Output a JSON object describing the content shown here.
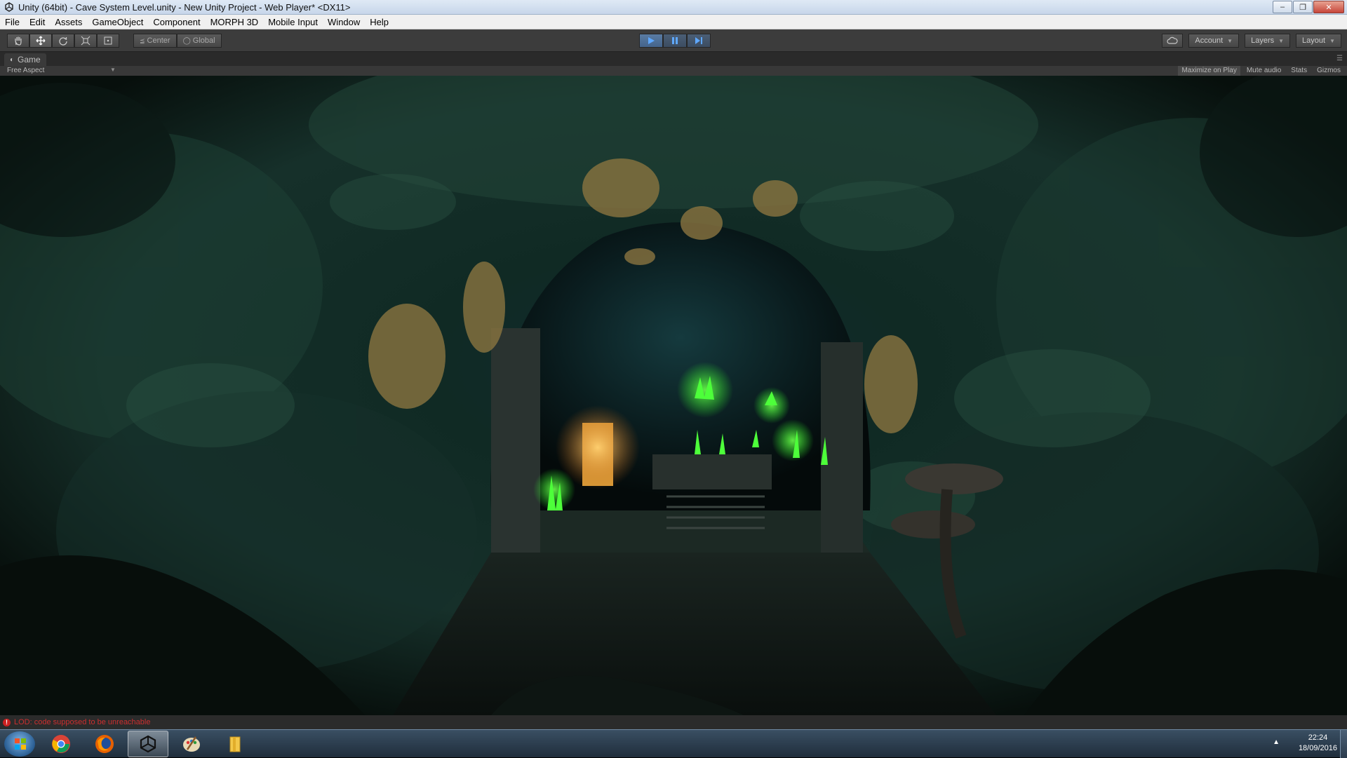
{
  "window": {
    "title": "Unity (64bit) - Cave System Level.unity - New Unity Project - Web Player* <DX11>"
  },
  "menu": [
    "File",
    "Edit",
    "Assets",
    "GameObject",
    "Component",
    "MORPH 3D",
    "Mobile Input",
    "Window",
    "Help"
  ],
  "toolbar": {
    "pivot_center": "Center",
    "pivot_global": "Global",
    "account_label": "Account",
    "layers_label": "Layers",
    "layout_label": "Layout",
    "play_mode_active": true
  },
  "game_view": {
    "tab_label": "Game",
    "aspect_label": "Free Aspect",
    "maximize_on_play": "Maximize on Play",
    "mute_audio": "Mute audio",
    "stats": "Stats",
    "gizmos": "Gizmos"
  },
  "console": {
    "error_message": "LOD: code supposed to be unreachable"
  },
  "taskbar": {
    "apps": [
      "start",
      "chrome",
      "firefox",
      "unity",
      "paint",
      "explorer"
    ],
    "active_app": "unity",
    "time": "22:24",
    "date": "18/09/2016"
  },
  "colors": {
    "editor_dark": "#3c3c3c",
    "play_blue": "#44648b",
    "error_red": "#cc2f2f",
    "cave_green": "#1f3a2e",
    "crystal_green": "#46ff3c",
    "torch_orange": "#f0a030"
  }
}
